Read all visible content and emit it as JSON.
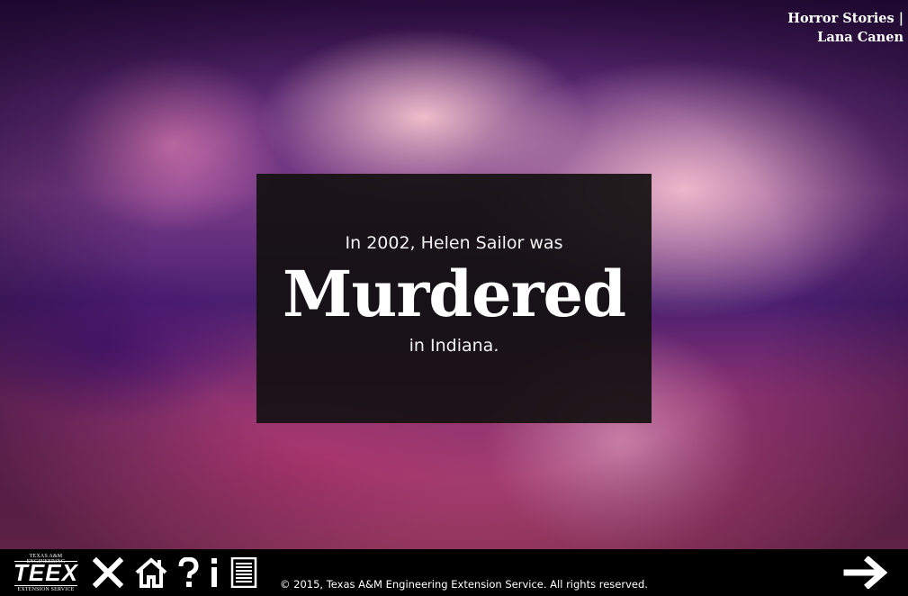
{
  "header": {
    "title_line1": "Horror Stories |",
    "title_line2": "Lana Canen"
  },
  "caption": {
    "line1": "In 2002, Helen Sailor was",
    "emphasis": "Murdered",
    "line3": "in Indiana."
  },
  "footer": {
    "logo": {
      "top_text": "TEXAS A&M ENGINEERING",
      "mark": "TEEX",
      "bottom_text": "EXTENSION SERVICE"
    },
    "controls": [
      {
        "name": "close-icon",
        "glyph": "close"
      },
      {
        "name": "home-icon",
        "glyph": "home"
      },
      {
        "name": "help-icon",
        "glyph": "question"
      },
      {
        "name": "info-icon",
        "glyph": "info"
      },
      {
        "name": "transcript-icon",
        "glyph": "document"
      }
    ],
    "copyright": "© 2015, Texas A&M Engineering Extension Service. All rights reserved.",
    "next_icon": "arrow-right-icon"
  },
  "colors": {
    "caption_bg": "#121010",
    "footer_bg": "#000000",
    "text": "#ffffff"
  }
}
